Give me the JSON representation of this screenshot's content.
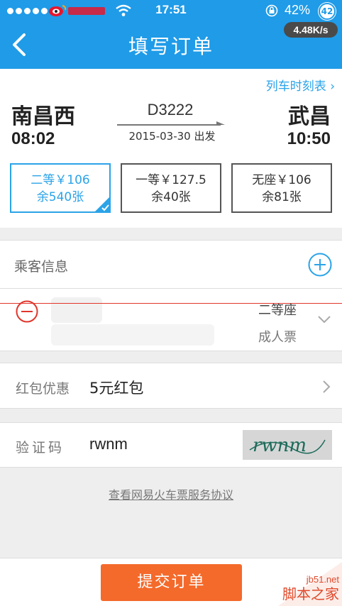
{
  "status_bar": {
    "time": "17:51",
    "battery": "42%",
    "badge": "42",
    "speed": "4.48K/s",
    "carrier_logo_text": "新浪微博"
  },
  "nav": {
    "title": "填写订单",
    "back_icon": "chevron-left-icon"
  },
  "train": {
    "timetable_link": "列车时刻表 ›",
    "from_station": "南昌西",
    "from_time": "08:02",
    "to_station": "武昌",
    "to_time": "10:50",
    "train_no": "D3222",
    "depart_date": "2015-03-30 出发"
  },
  "seats": [
    {
      "line1": "二等￥106",
      "line2": "余540张",
      "selected": true
    },
    {
      "line1": "一等￥127.5",
      "line2": "余40张",
      "selected": false
    },
    {
      "line1": "无座￥106",
      "line2": "余81张",
      "selected": false
    }
  ],
  "passenger": {
    "title": "乘客信息",
    "seat_class": "二等座",
    "ticket_type": "成人票"
  },
  "redpack": {
    "label": "红包优惠",
    "value": "5元红包"
  },
  "captcha": {
    "label": "验证码",
    "value": "rwnm",
    "image_text": "rwnm"
  },
  "agreement": {
    "prefix": "查看",
    "link": "网易火车票服务协议"
  },
  "footer": {
    "submit_label": "提交订单",
    "watermark_url": "jb51.net",
    "watermark_name": "脚本之家"
  },
  "colors": {
    "primary": "#1f9be8",
    "accent_blue": "#2aa3e8",
    "submit": "#f46a2b",
    "remove_red": "#e0352b"
  }
}
